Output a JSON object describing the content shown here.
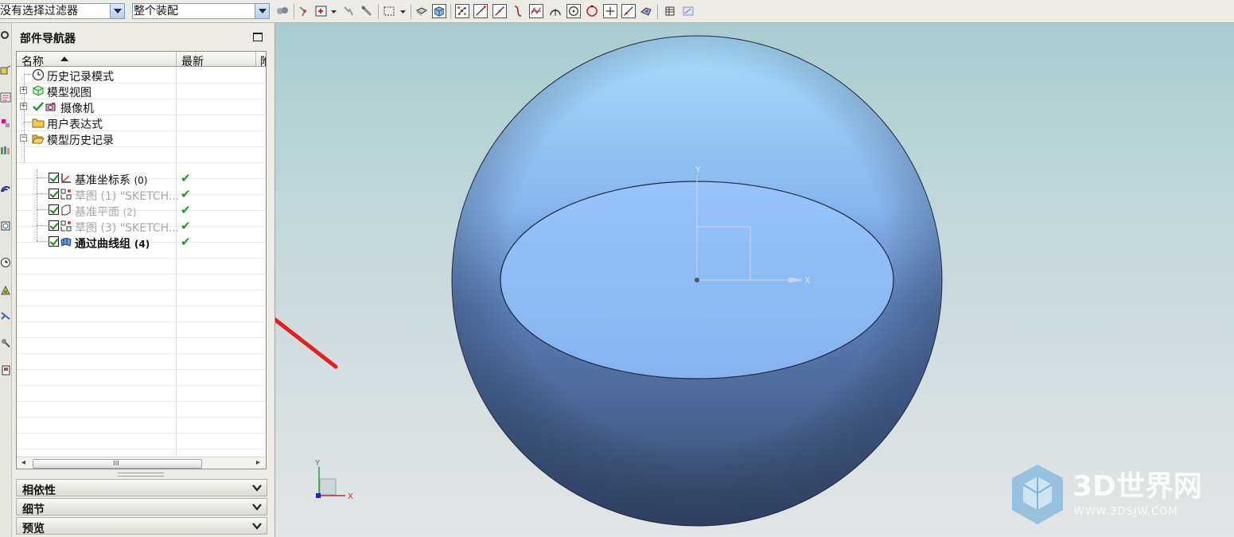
{
  "toolbar": {
    "filter_value": "没有选择过滤器",
    "assembly_value": "整个装配"
  },
  "navigator": {
    "title": "部件导航器",
    "columns": {
      "name": "名称",
      "latest": "最新",
      "third": "附"
    },
    "rows": [
      {
        "label": "历史记录模式",
        "num": "",
        "icon": "clock-icon"
      },
      {
        "label": "模型视图",
        "num": "",
        "icon": "model-view-icon"
      },
      {
        "label": "摄像机",
        "num": "",
        "icon": "camera-icon"
      },
      {
        "label": "用户表达式",
        "num": "",
        "icon": "folder-icon"
      },
      {
        "label": "模型历史记录",
        "num": "",
        "icon": "folder-open-icon"
      },
      {
        "label": "基准坐标系",
        "num": "(0)",
        "icon": "datum-csys-icon",
        "latest": "✔"
      },
      {
        "label": "草图 (1) \"SKETCH...",
        "num": "",
        "icon": "sketch-icon",
        "latest": "✔"
      },
      {
        "label": "基准平面",
        "num": "(2)",
        "icon": "datum-plane-icon",
        "latest": "✔"
      },
      {
        "label": "草图 (3) \"SKETCH...",
        "num": "",
        "icon": "sketch-icon",
        "latest": "✔"
      },
      {
        "label": "通过曲线组",
        "num": "(4)",
        "icon": "through-curves-icon",
        "latest": "✔"
      }
    ],
    "scrollbar_grip": "III"
  },
  "sections": {
    "dependencies": "相依性",
    "details": "细节",
    "preview": "预览"
  },
  "viewport": {
    "axis_x": "X",
    "axis_y": "Y"
  },
  "watermark": {
    "main": "3D世界网",
    "url": "WWW.3DSJW.COM"
  },
  "colors": {
    "annotation_arrow": "#e41f1f",
    "sphere_top": "#a9dcfb",
    "sphere_bottom": "#3a4a6e",
    "cut_face": "#8fbaf5"
  }
}
